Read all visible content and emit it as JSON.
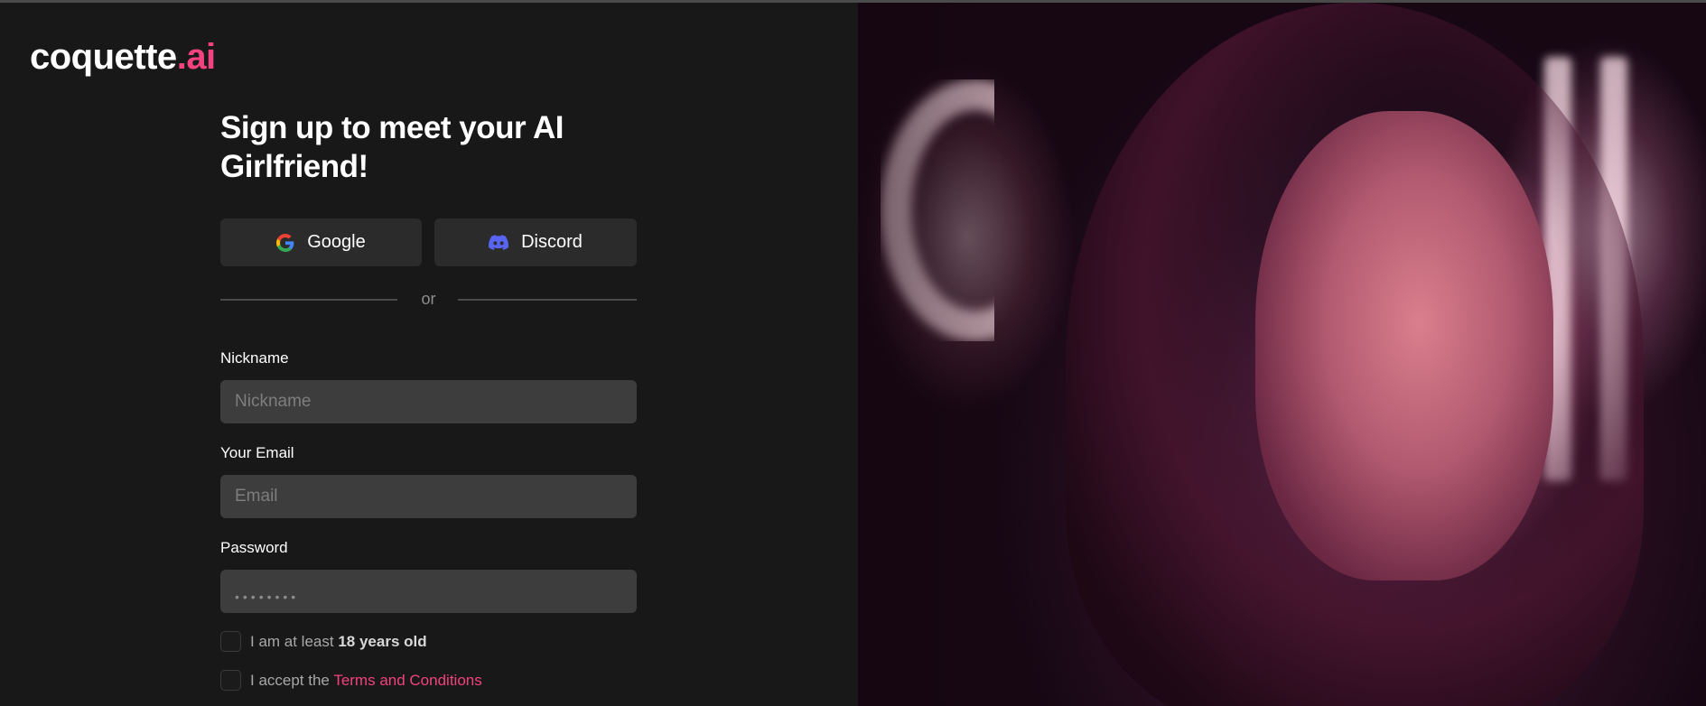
{
  "brand": {
    "name": "coquette",
    "dot": ".",
    "suffix": "ai"
  },
  "signup": {
    "title": "Sign up to meet your AI Girlfriend!",
    "google_label": "Google",
    "discord_label": "Discord",
    "divider_text": "or",
    "nickname": {
      "label": "Nickname",
      "placeholder": "Nickname",
      "value": ""
    },
    "email": {
      "label": "Your Email",
      "placeholder": "Email",
      "value": ""
    },
    "password": {
      "label": "Password",
      "masked": "••••••••"
    },
    "age_check": {
      "prefix": "I am at least ",
      "bold": "18 years old"
    },
    "terms_check": {
      "prefix": "I accept the ",
      "link": "Terms and Conditions"
    }
  },
  "colors": {
    "background": "#181818",
    "button_bg": "#2b2b2b",
    "input_bg": "#3d3d3d",
    "accent": "#f2427f",
    "discord": "#5865f2"
  },
  "icons": {
    "google": "google-icon",
    "discord": "discord-icon"
  }
}
